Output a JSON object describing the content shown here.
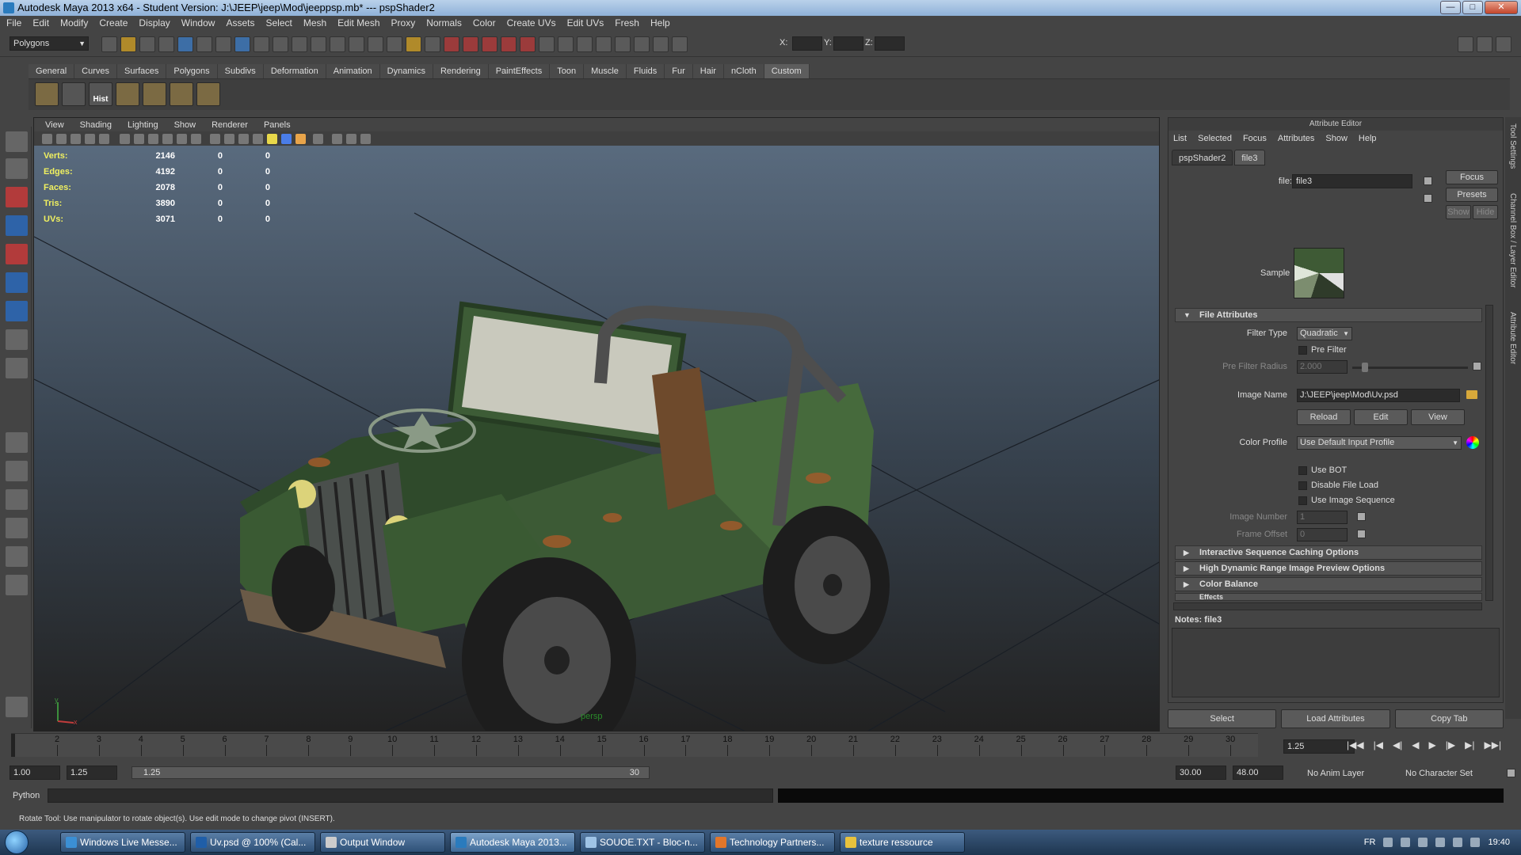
{
  "window": {
    "title": "Autodesk Maya 2013 x64 - Student Version: J:\\JEEP\\jeep\\Mod\\jeeppsp.mb*   ---   pspShader2",
    "min": "—",
    "max": "□",
    "close": "✕"
  },
  "menubar": [
    "File",
    "Edit",
    "Modify",
    "Create",
    "Display",
    "Window",
    "Assets",
    "Select",
    "Mesh",
    "Edit Mesh",
    "Proxy",
    "Normals",
    "Color",
    "Create UVs",
    "Edit UVs",
    "Fresh",
    "Help"
  ],
  "statusline": {
    "mode": "Polygons",
    "x_label": "X:",
    "y_label": "Y:",
    "z_label": "Z:"
  },
  "shelf": {
    "tabs": [
      "General",
      "Curves",
      "Surfaces",
      "Polygons",
      "Subdivs",
      "Deformation",
      "Animation",
      "Dynamics",
      "Rendering",
      "PaintEffects",
      "Toon",
      "Muscle",
      "Fluids",
      "Fur",
      "Hair",
      "nCloth",
      "Custom"
    ],
    "active_tab": "Custom",
    "hist_label": "Hist"
  },
  "viewport": {
    "menu": [
      "View",
      "Shading",
      "Lighting",
      "Show",
      "Renderer",
      "Panels"
    ],
    "hud": [
      {
        "label": "Verts:",
        "v1": "2146",
        "v2": "0",
        "v3": "0"
      },
      {
        "label": "Edges:",
        "v1": "4192",
        "v2": "0",
        "v3": "0"
      },
      {
        "label": "Faces:",
        "v1": "2078",
        "v2": "0",
        "v3": "0"
      },
      {
        "label": "Tris:",
        "v1": "3890",
        "v2": "0",
        "v3": "0"
      },
      {
        "label": "UVs:",
        "v1": "3071",
        "v2": "0",
        "v3": "0"
      }
    ],
    "camera_name": "persp",
    "axis_y": "y",
    "axis_x": "x"
  },
  "attribute_editor": {
    "title": "Attribute Editor",
    "menu": [
      "List",
      "Selected",
      "Focus",
      "Attributes",
      "Show",
      "Help"
    ],
    "tabs": [
      "pspShader2",
      "file3"
    ],
    "active_tab": "file3",
    "file_label": "file:",
    "file_value": "file3",
    "focus_btn": "Focus",
    "presets_btn": "Presets",
    "show_btn": "Show",
    "hide_btn": "Hide",
    "sample_label": "Sample",
    "sections": {
      "file_attributes": "File Attributes",
      "interactive": "Interactive Sequence Caching Options",
      "hdr": "High Dynamic Range Image Preview Options",
      "color_balance": "Color Balance",
      "effects": "Effects"
    },
    "filter_type_label": "Filter Type",
    "filter_type_value": "Quadratic",
    "pre_filter_label": "Pre Filter",
    "pre_filter_radius_label": "Pre Filter Radius",
    "pre_filter_radius_value": "2.000",
    "image_name_label": "Image Name",
    "image_name_value": "J:\\JEEP\\jeep\\Mod\\Uv.psd",
    "reload_btn": "Reload",
    "edit_btn": "Edit",
    "view_btn": "View",
    "color_profile_label": "Color Profile",
    "color_profile_value": "Use Default Input Profile",
    "use_bot": "Use BOT",
    "disable_file_load": "Disable File Load",
    "use_image_sequence": "Use Image Sequence",
    "image_number_label": "Image Number",
    "image_number_value": "1",
    "frame_offset_label": "Frame Offset",
    "frame_offset_value": "0",
    "notes_label": "Notes:  file3",
    "bottom_buttons": [
      "Select",
      "Load Attributes",
      "Copy Tab"
    ]
  },
  "right_strip": [
    "Tool Settings",
    "Channel Box / Layer Editor",
    "Attribute Editor"
  ],
  "timeslider": {
    "ticks": [
      "2",
      "3",
      "4",
      "5",
      "6",
      "7",
      "8",
      "9",
      "10",
      "11",
      "12",
      "13",
      "14",
      "15",
      "16",
      "17",
      "18",
      "19",
      "20",
      "21",
      "22",
      "23",
      "24",
      "25",
      "26",
      "27",
      "28",
      "29",
      "30"
    ],
    "current": "1.25",
    "controls": [
      "|◀◀",
      "|◀",
      "◀|",
      "◀",
      "▶",
      "|▶",
      "▶|",
      "▶▶|"
    ]
  },
  "rangeslider": {
    "start": "1.00",
    "playstart": "1.25",
    "bar_start": "1.25",
    "bar_end": "30",
    "playend": "30.00",
    "end": "48.00",
    "anim_layer": "No Anim Layer",
    "char_set": "No Character Set"
  },
  "cmdline": {
    "label": "Python"
  },
  "helpline": "Rotate Tool: Use manipulator to rotate object(s). Use edit mode to change pivot (INSERT).",
  "taskbar": {
    "tasks": [
      {
        "label": "Windows Live Messe...",
        "color": "#3b8fd4"
      },
      {
        "label": "Uv.psd @ 100% (Cal...",
        "color": "#1f5ea8"
      },
      {
        "label": "Output Window",
        "color": "#cccccc"
      },
      {
        "label": "Autodesk Maya 2013...",
        "color": "#2a7bbd"
      },
      {
        "label": "SOUOE.TXT - Bloc-n...",
        "color": "#9fc4e6"
      },
      {
        "label": "Technology Partners...",
        "color": "#e2762a"
      },
      {
        "label": "texture ressource",
        "color": "#e8c23d"
      }
    ],
    "lang": "FR",
    "time": "19:40"
  }
}
